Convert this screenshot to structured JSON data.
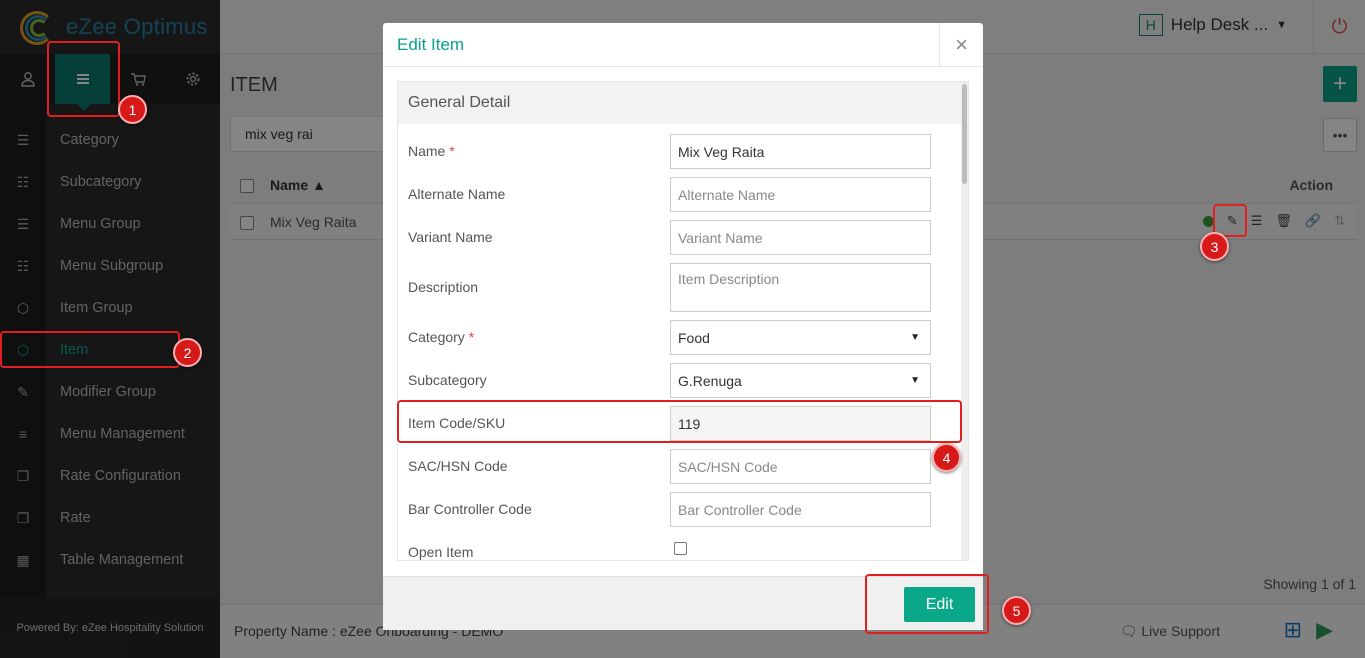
{
  "app": {
    "logo_text": "eZee Optimus",
    "powered_by": "Powered By: eZee Hospitality Solution",
    "brand_color": "#0aa08c"
  },
  "header": {
    "help_badge": "H",
    "help_label": "Help Desk ...",
    "power_icon": "power-icon"
  },
  "sidebar": {
    "top_icons": [
      "user-icon",
      "menu-icon",
      "cart-icon",
      "gear-icon"
    ],
    "items": [
      {
        "label": "Category",
        "icon": "list-icon"
      },
      {
        "label": "Subcategory",
        "icon": "sublist-icon"
      },
      {
        "label": "Menu Group",
        "icon": "list-icon"
      },
      {
        "label": "Menu Subgroup",
        "icon": "sublist-icon"
      },
      {
        "label": "Item Group",
        "icon": "cube-icon"
      },
      {
        "label": "Item",
        "icon": "cube-icon",
        "active": true
      },
      {
        "label": "Modifier Group",
        "icon": "edit-icon"
      },
      {
        "label": "Menu Management",
        "icon": "bars-icon"
      },
      {
        "label": "Rate Configuration",
        "icon": "copy-icon"
      },
      {
        "label": "Rate",
        "icon": "copy-icon"
      },
      {
        "label": "Table Management",
        "icon": "grid-icon"
      }
    ]
  },
  "main": {
    "title": "ITEM",
    "search_value": "mix veg rai",
    "table": {
      "columns": [
        "Name ▲",
        "Action"
      ],
      "rows": [
        {
          "name": "Mix Veg Raita"
        }
      ]
    },
    "showing": "Showing 1 of 1"
  },
  "footer": {
    "property": "Property Name : eZee Onboarding - DEMO",
    "live_support": "Live Support"
  },
  "modal": {
    "title": "Edit Item",
    "close": "×",
    "section": "General Detail",
    "fields": {
      "name": {
        "label": "Name",
        "value": "Mix Veg Raita"
      },
      "alt_name": {
        "label": "Alternate Name",
        "placeholder": "Alternate Name"
      },
      "variant": {
        "label": "Variant Name",
        "placeholder": "Variant Name"
      },
      "description": {
        "label": "Description",
        "placeholder": "Item Description"
      },
      "category": {
        "label": "Category",
        "value": "Food"
      },
      "subcategory": {
        "label": "Subcategory",
        "value": "G.Renuga"
      },
      "sku": {
        "label": "Item Code/SKU",
        "value": "119"
      },
      "sac": {
        "label": "SAC/HSN Code",
        "placeholder": "SAC/HSN Code"
      },
      "bar": {
        "label": "Bar Controller Code",
        "placeholder": "Bar Controller Code"
      },
      "open_item": {
        "label": "Open Item"
      }
    },
    "required_mark": "*",
    "edit_button": "Edit"
  },
  "annotations": [
    "1",
    "2",
    "3",
    "4",
    "5"
  ]
}
